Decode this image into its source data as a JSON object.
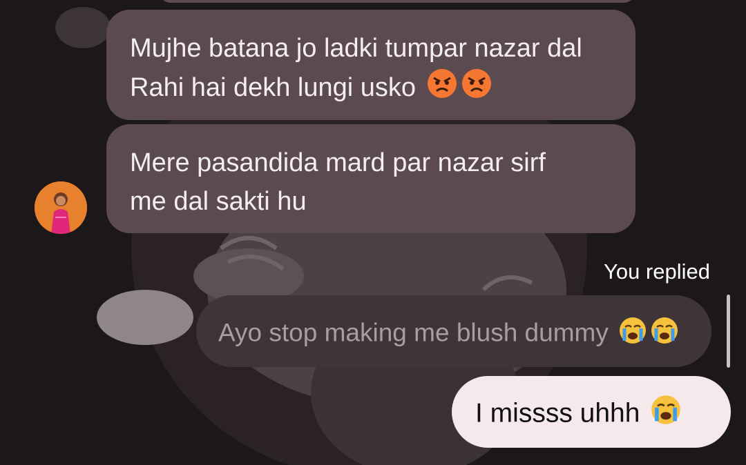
{
  "messages": {
    "received_1": "Mujhe batana jo ladki tumpar nazar dal Rahi hai dekh lungi usko",
    "received_2_line1": "Mere pasandida mard par nazar sirf",
    "received_2_line2": "me dal sakti hu",
    "reply_label": "You replied",
    "quoted_text": "Ayo stop making me blush dummy",
    "sent_text": "I missss uhhh"
  },
  "icons": {
    "angry_face": "angry-face-emoji",
    "crying_face": "loudly-crying-face-emoji"
  },
  "colors": {
    "background": "#1c1718",
    "received_bubble": "#5b4a4f",
    "quoted_bubble": "#3f3437",
    "sent_bubble": "#f5e9ec"
  }
}
